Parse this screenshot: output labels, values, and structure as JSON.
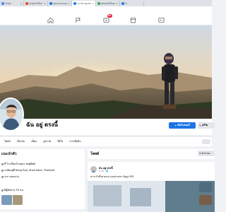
{
  "browser_tabs": [
    {
      "label": "ร้านค้า",
      "favicon_color": "#4285f4",
      "active": false
    },
    {
      "label": "ครอบครัวมีลม ไอพอลุบัติต คุณชาวบ้าน",
      "favicon_color": "#ea4335",
      "active": false
    },
    {
      "label": "Meta Business Suite",
      "favicon_color": "#1877f2",
      "active": false
    },
    {
      "label": "(7) ฉัน อยู่ ตรงนี้ | Facebook",
      "favicon_color": "#1877f2",
      "active": true
    },
    {
      "label": "ทดลองวิธี ฝั่งตะวันออก ช่องทางรายได้",
      "favicon_color": "#34a853",
      "active": false
    },
    {
      "label": "ร้า",
      "favicon_color": "#1877f2",
      "active": false
    }
  ],
  "fb_nav": {
    "home_icon": "home-icon",
    "pages_icon": "flag-icon",
    "watch_icon": "video-icon",
    "watch_badge": "9+",
    "marketplace_icon": "store-icon",
    "gaming_icon": "gaming-icon"
  },
  "profile": {
    "name": "ฉัน อยู่ ตรงนี้",
    "add_story_label": "เพิ่มในสตอรี่",
    "edit_label": "แก้ไข"
  },
  "profile_tabs": [
    "โพสต์",
    "เกี่ยวกับ",
    "เพื่อน",
    "รูปภาพ",
    "วิดีโอ",
    "การเช็คอิน"
  ],
  "intro": {
    "title": "แนะนำตัว",
    "rows": [
      "ที่ โรงเรียนบ้านอุดร ชมพูทิพย์",
      "อาศัยอยู่ที่ Nong Rua, Khon Kaen, Thailand",
      "จาก ขอนแก่น",
      "มีผู้ติดตาม 53 คน"
    ]
  },
  "posts": {
    "title": "โพสต์",
    "filter_label": "ตัวกรอง",
    "first_post": {
      "author": "ฉัน อยู่ ตรงนี้",
      "meta": "1 วัน · 🌐",
      "text": "สาวางโลกิ้งสวยงาม บอกต่างหาก ข้อมูล 555"
    }
  },
  "colors": {
    "fb_blue": "#1b74e4",
    "badge_red": "#e41e3f",
    "page_bg": "#f0f2f5"
  }
}
